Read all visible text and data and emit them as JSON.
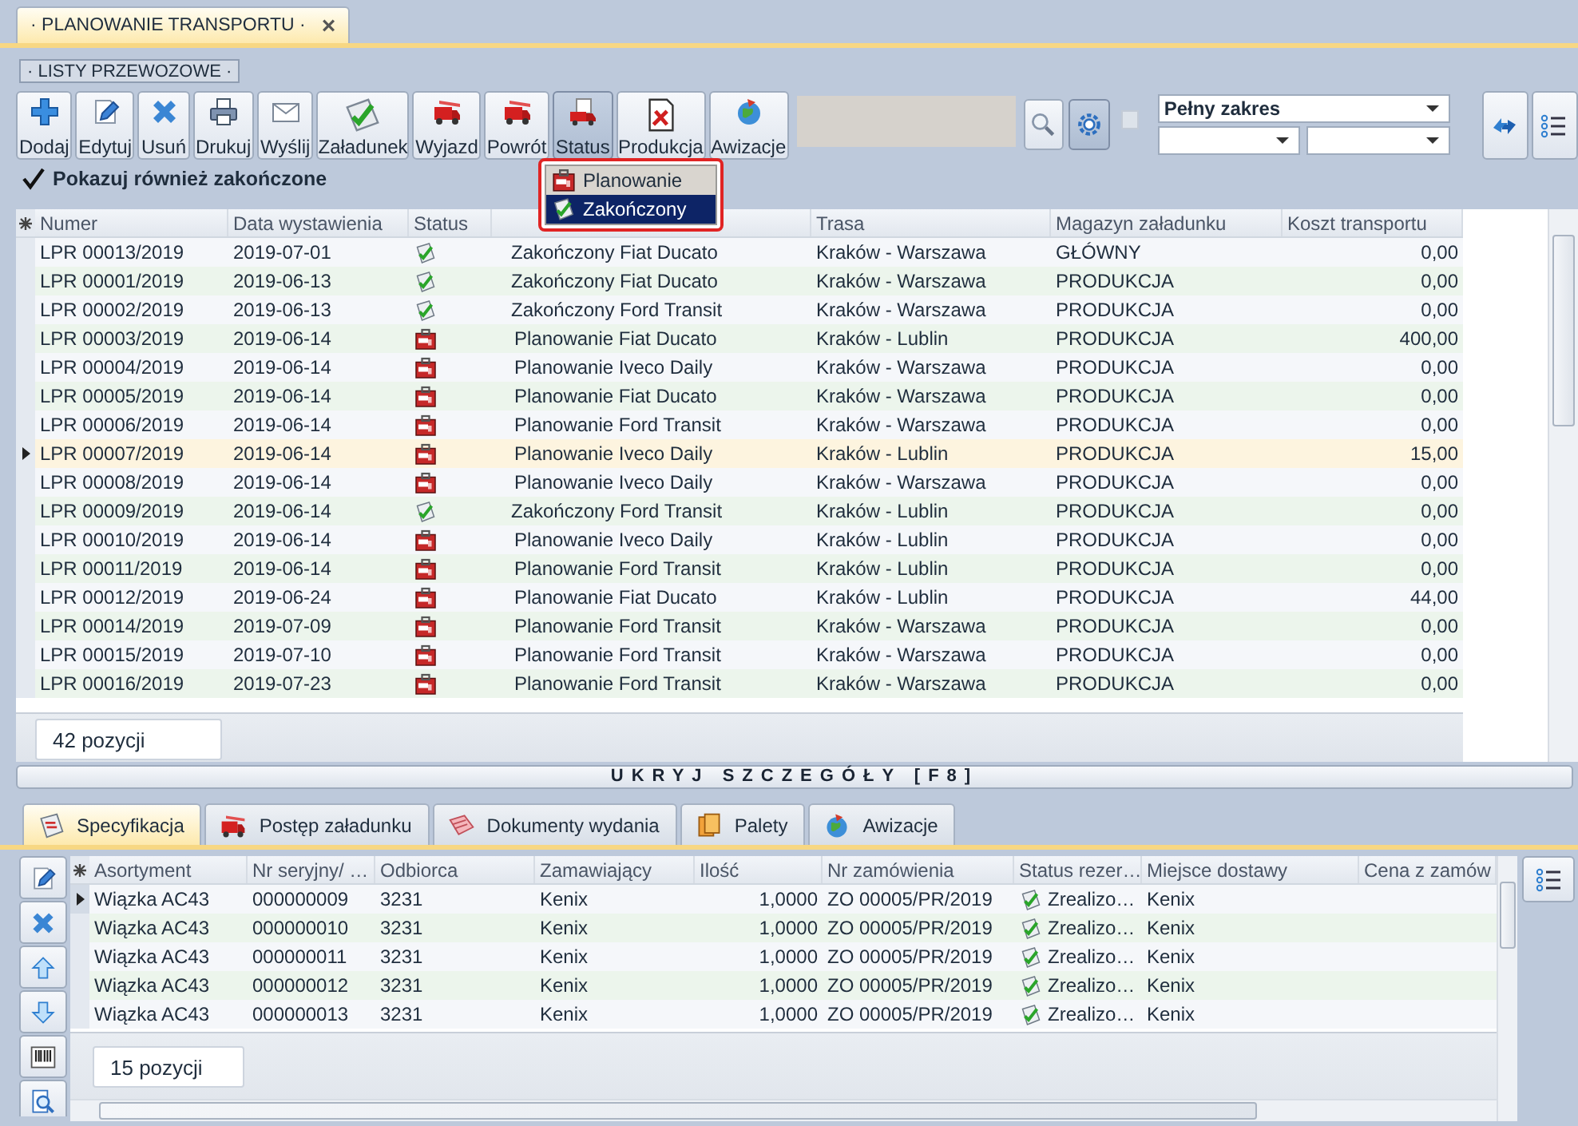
{
  "document_tab": {
    "title": "· PLANOWANIE TRANSPORTU ·",
    "close": "×",
    "selected": true
  },
  "section_label": "· LISTY PRZEWOZOWE ·",
  "toolbar": {
    "buttons": [
      {
        "label": "Dodaj",
        "kind": "add",
        "pressed": false
      },
      {
        "label": "Edytuj",
        "kind": "edit",
        "pressed": false
      },
      {
        "label": "Usuń",
        "kind": "delete",
        "pressed": false
      },
      {
        "label": "Drukuj",
        "kind": "print",
        "pressed": false
      },
      {
        "label": "Wyślij",
        "kind": "send",
        "pressed": false
      },
      {
        "label": "Załadunek",
        "kind": "load",
        "pressed": false
      },
      {
        "label": "Wyjazd",
        "kind": "truck",
        "pressed": false
      },
      {
        "label": "Powrót",
        "kind": "truck",
        "pressed": false
      },
      {
        "label": "Status",
        "kind": "status",
        "pressed": true
      },
      {
        "label": "Produkcja",
        "kind": "produce",
        "pressed": false
      },
      {
        "label": "Awizacje",
        "kind": "notice",
        "pressed": false
      }
    ],
    "search_button": {
      "pressed": false
    },
    "options_button": {
      "pressed": true
    },
    "toggle": {
      "checked": false
    },
    "range": {
      "value": "Pełny zakres"
    }
  },
  "show_completed": {
    "label": "Pokazuj również zakończone",
    "checked": true
  },
  "status_menu": {
    "items": [
      {
        "label": "Planowanie",
        "kind": "planned",
        "selected": false
      },
      {
        "label": "Zakończony",
        "kind": "done",
        "selected": true
      }
    ]
  },
  "grid": {
    "columns": [
      "Numer",
      "Data wystawienia",
      "Status",
      "Trasa",
      "Magazyn załadunku",
      "Koszt transportu"
    ],
    "rows": [
      {
        "cells": [
          "LPR 00013/2019",
          "2019-07-01",
          "Zakończony Fiat Ducato",
          "Kraków - Warszawa",
          "GŁÓWNY",
          "0,00"
        ],
        "kind": "done",
        "selected": false
      },
      {
        "cells": [
          "LPR 00001/2019",
          "2019-06-13",
          "Zakończony Fiat Ducato",
          "Kraków - Warszawa",
          "PRODUKCJA",
          "0,00"
        ],
        "kind": "done",
        "selected": false
      },
      {
        "cells": [
          "LPR 00002/2019",
          "2019-06-13",
          "Zakończony Ford Transit",
          "Kraków - Warszawa",
          "PRODUKCJA",
          "0,00"
        ],
        "kind": "done",
        "selected": false
      },
      {
        "cells": [
          "LPR 00003/2019",
          "2019-06-14",
          "Planowanie Fiat Ducato",
          "Kraków - Lublin",
          "PRODUKCJA",
          "400,00"
        ],
        "kind": "planned",
        "selected": false
      },
      {
        "cells": [
          "LPR 00004/2019",
          "2019-06-14",
          "Planowanie Iveco Daily",
          "Kraków - Warszawa",
          "PRODUKCJA",
          "0,00"
        ],
        "kind": "planned",
        "selected": false
      },
      {
        "cells": [
          "LPR 00005/2019",
          "2019-06-14",
          "Planowanie Fiat Ducato",
          "Kraków - Warszawa",
          "PRODUKCJA",
          "0,00"
        ],
        "kind": "planned",
        "selected": false
      },
      {
        "cells": [
          "LPR 00006/2019",
          "2019-06-14",
          "Planowanie Ford Transit",
          "Kraków - Warszawa",
          "PRODUKCJA",
          "0,00"
        ],
        "kind": "planned",
        "selected": false
      },
      {
        "cells": [
          "LPR 00007/2019",
          "2019-06-14",
          "Planowanie Iveco Daily",
          "Kraków - Lublin",
          "PRODUKCJA",
          "15,00"
        ],
        "kind": "planned",
        "selected": true
      },
      {
        "cells": [
          "LPR 00008/2019",
          "2019-06-14",
          "Planowanie Iveco Daily",
          "Kraków - Warszawa",
          "PRODUKCJA",
          "0,00"
        ],
        "kind": "planned",
        "selected": false
      },
      {
        "cells": [
          "LPR 00009/2019",
          "2019-06-14",
          "Zakończony Ford Transit",
          "Kraków - Lublin",
          "PRODUKCJA",
          "0,00"
        ],
        "kind": "done",
        "selected": false
      },
      {
        "cells": [
          "LPR 00010/2019",
          "2019-06-14",
          "Planowanie Iveco Daily",
          "Kraków - Lublin",
          "PRODUKCJA",
          "0,00"
        ],
        "kind": "planned",
        "selected": false
      },
      {
        "cells": [
          "LPR 00011/2019",
          "2019-06-14",
          "Planowanie Ford Transit",
          "Kraków - Lublin",
          "PRODUKCJA",
          "0,00"
        ],
        "kind": "planned",
        "selected": false
      },
      {
        "cells": [
          "LPR 00012/2019",
          "2019-06-24",
          "Planowanie Fiat Ducato",
          "Kraków - Lublin",
          "PRODUKCJA",
          "44,00"
        ],
        "kind": "planned",
        "selected": false
      },
      {
        "cells": [
          "LPR 00014/2019",
          "2019-07-09",
          "Planowanie Ford Transit",
          "Kraków - Warszawa",
          "PRODUKCJA",
          "0,00"
        ],
        "kind": "planned",
        "selected": false
      },
      {
        "cells": [
          "LPR 00015/2019",
          "2019-07-10",
          "Planowanie Ford Transit",
          "Kraków - Warszawa",
          "PRODUKCJA",
          "0,00"
        ],
        "kind": "planned",
        "selected": false
      },
      {
        "cells": [
          "LPR 00016/2019",
          "2019-07-23",
          "Planowanie Ford Transit",
          "Kraków - Warszawa",
          "PRODUKCJA",
          "0,00"
        ],
        "kind": "planned",
        "selected": false
      }
    ],
    "count": "42 pozycji"
  },
  "hide_details": "UKRYJ SZCZEGÓŁY [F8]",
  "detail": {
    "tabs": [
      {
        "label": "Specyfikacja",
        "kind": "spec",
        "selected": true
      },
      {
        "label": "Postęp załadunku",
        "kind": "truck",
        "selected": false
      },
      {
        "label": "Dokumenty wydania",
        "kind": "papers",
        "selected": false
      },
      {
        "label": "Palety",
        "kind": "pallets",
        "selected": false
      },
      {
        "label": "Awizacje",
        "kind": "notice",
        "selected": false
      }
    ],
    "side_buttons": [
      {
        "kind": "edit"
      },
      {
        "kind": "delete"
      },
      {
        "kind": "up"
      },
      {
        "kind": "down"
      },
      {
        "kind": "barcode"
      },
      {
        "kind": "zoom"
      }
    ],
    "columns": [
      "Asortyment",
      "Nr seryjny/ …",
      "Odbiorca",
      "Zamawiający",
      "Ilość",
      "Nr zamówienia",
      "Status rezer…",
      "Miejsce dostawy",
      "Cena z zamów"
    ],
    "rows": [
      {
        "cells": [
          "Wiązka AC43",
          "000000009",
          "3231",
          "Kenix",
          "1,0000",
          "ZO 00005/PR/2019",
          "Zrealizo…",
          "Kenix"
        ],
        "kind": "done",
        "selected": true
      },
      {
        "cells": [
          "Wiązka AC43",
          "000000010",
          "3231",
          "Kenix",
          "1,0000",
          "ZO 00005/PR/2019",
          "Zrealizo…",
          "Kenix"
        ],
        "kind": "done",
        "selected": false
      },
      {
        "cells": [
          "Wiązka AC43",
          "000000011",
          "3231",
          "Kenix",
          "1,0000",
          "ZO 00005/PR/2019",
          "Zrealizo…",
          "Kenix"
        ],
        "kind": "done",
        "selected": false
      },
      {
        "cells": [
          "Wiązka AC43",
          "000000012",
          "3231",
          "Kenix",
          "1,0000",
          "ZO 00005/PR/2019",
          "Zrealizo…",
          "Kenix"
        ],
        "kind": "done",
        "selected": false
      },
      {
        "cells": [
          "Wiązka AC43",
          "000000013",
          "3231",
          "Kenix",
          "1,0000",
          "ZO 00005/PR/2019",
          "Zrealizo…",
          "Kenix"
        ],
        "kind": "done",
        "selected": false
      }
    ],
    "count": "15 pozycji"
  }
}
